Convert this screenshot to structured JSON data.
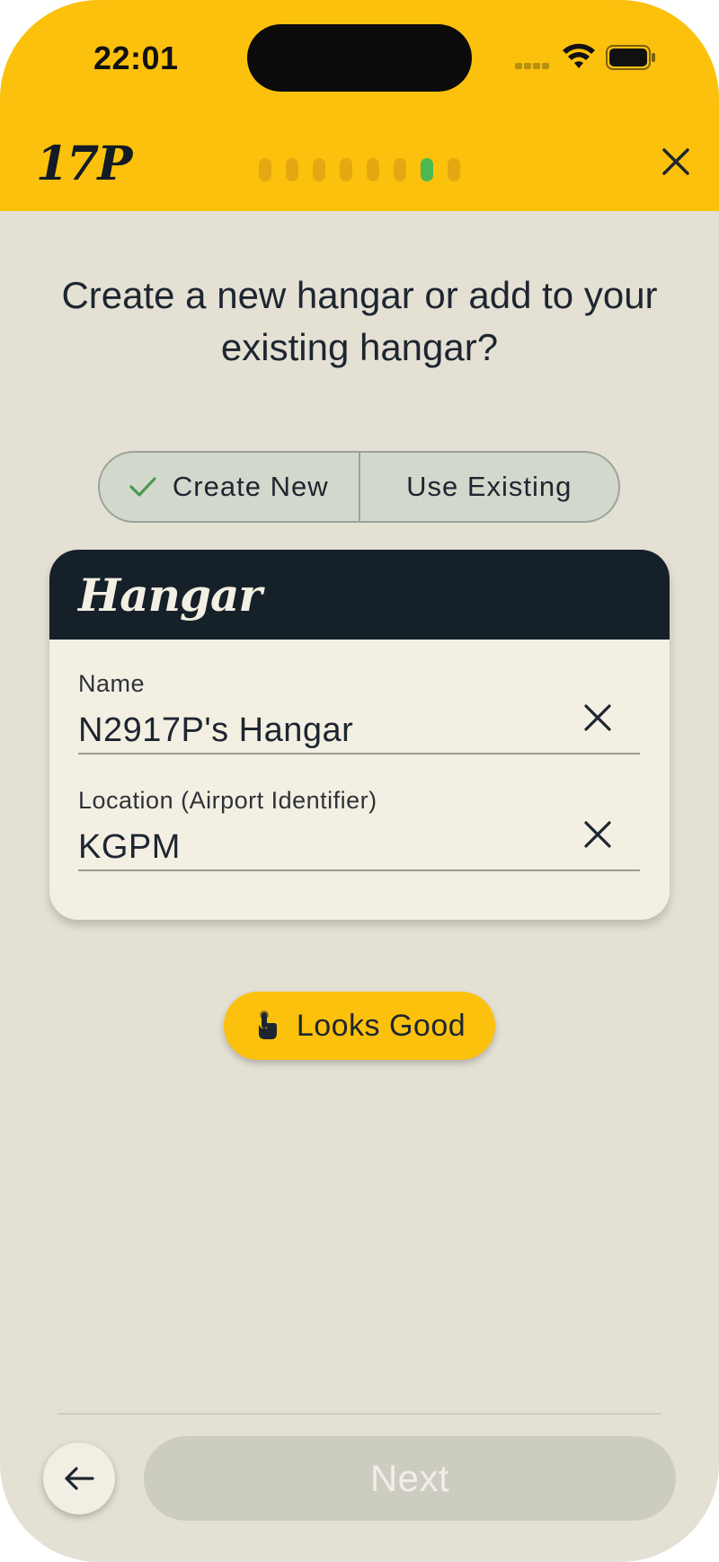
{
  "status_bar": {
    "time": "22:01",
    "icons": [
      "signal-icon",
      "wifi-icon",
      "battery-icon"
    ]
  },
  "header": {
    "logo": "17P",
    "progress": {
      "total_steps": 8,
      "current_step": 7
    },
    "close_icon": "close-icon"
  },
  "title": "Create a new hangar or add to your existing hangar?",
  "segmented": {
    "options": [
      {
        "label": "Create New",
        "selected": true
      },
      {
        "label": "Use Existing",
        "selected": false
      }
    ]
  },
  "card": {
    "title": "Hangar",
    "fields": [
      {
        "label": "Name",
        "value": "N2917P's Hangar"
      },
      {
        "label": "Location (Airport Identifier)",
        "value": "KGPM"
      }
    ]
  },
  "looks_good": {
    "label": "Looks Good",
    "icon": "tap-hand-icon"
  },
  "footer": {
    "back_icon": "arrow-left-icon",
    "next_label": "Next"
  },
  "colors": {
    "accent_yellow": "#fcc10c",
    "progress_active": "#4cb852",
    "card_header": "#152029",
    "background": "#e4e0d4"
  }
}
